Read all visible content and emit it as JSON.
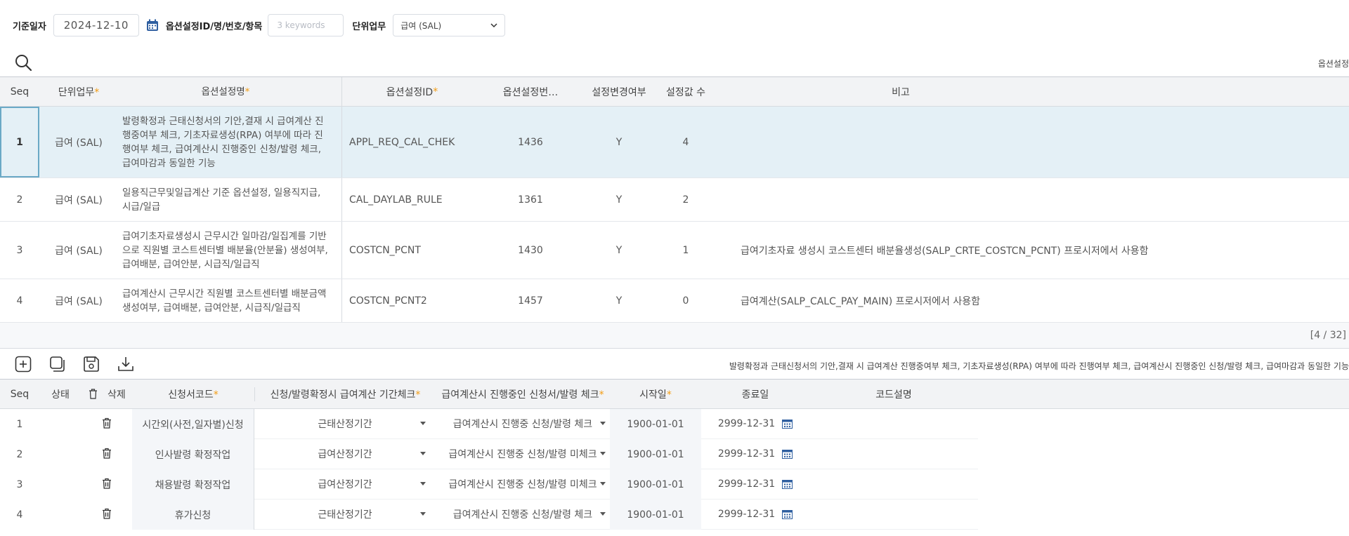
{
  "filter": {
    "base_date_label": "기준일자",
    "base_date_value": "2024-12-10",
    "option_label": "옵션설정ID/명/번호/항목",
    "keyword_placeholder": "3 keywords",
    "unit_label": "단위업무",
    "unit_value": "급여 (SAL)"
  },
  "top_right_label": "옵션설정",
  "grid1": {
    "headers": {
      "seq": "Seq",
      "unit": "단위업무",
      "name": "옵션설정명",
      "id": "옵션설정ID",
      "num": "옵션설정번…",
      "changed": "설정변경여부",
      "count": "설정값 수",
      "note": "비고"
    },
    "rows": [
      {
        "seq": "1",
        "unit": "급여 (SAL)",
        "name": "발령확정과 근태신청서의 기안,결재 시 급여계산 진행중여부 체크,  기초자료생성(RPA) 여부에 따라 진행여부 체크, 급여계산시 진행중인 신청/발령 체크, 급여마감과 동일한 기능",
        "id": "APPL_REQ_CAL_CHEK",
        "num": "1436",
        "changed": "Y",
        "count": "4",
        "note": ""
      },
      {
        "seq": "2",
        "unit": "급여 (SAL)",
        "name": "일용직근무및일급계산 기준 옵션설정, 일용직지급, 시급/일급",
        "id": "CAL_DAYLAB_RULE",
        "num": "1361",
        "changed": "Y",
        "count": "2",
        "note": ""
      },
      {
        "seq": "3",
        "unit": "급여 (SAL)",
        "name": "급여기초자료생성시 근무시간 일마감/일집계를 기반으로 직원별 코스트센터별 배분율(안분율) 생성여부, 급여배분, 급여안분, 시급직/일급직",
        "id": "COSTCN_PCNT",
        "num": "1430",
        "changed": "Y",
        "count": "1",
        "note": "급여기초자료 생성시 코스트센터 배분율생성(SALP_CRTE_COSTCN_PCNT) 프로시저에서 사용함"
      },
      {
        "seq": "4",
        "unit": "급여 (SAL)",
        "name": "급여계산시 근무시간 직원별 코스트센터별 배분금액 생성여부, 급여배분, 급여안분, 시급직/일급직",
        "id": "COSTCN_PCNT2",
        "num": "1457",
        "changed": "Y",
        "count": "0",
        "note": "급여계산(SALP_CALC_PAY_MAIN) 프로시저에서 사용함"
      }
    ],
    "paging": "[4 / 32]"
  },
  "detail_description": "발령확정과 근태신청서의 기안,결재 시 급여계산 진행중여부 체크, 기초자료생성(RPA) 여부에 따라 진행여부 체크, 급여계산시 진행중인 신청/발령 체크, 급여마감과 동일한 기능",
  "grid2": {
    "headers": {
      "seq": "Seq",
      "status": "상태",
      "delete": "삭제",
      "code": "신청서코드",
      "chk1": "신청/발령확정시 급여계산 기간체크",
      "chk2": "급여계산시 진행중인 신청서/발령 체크",
      "start": "시작일",
      "end": "종료일",
      "desc": "코드설명"
    },
    "rows": [
      {
        "seq": "1",
        "code": "시간외(사전,일자별)신청",
        "chk1": "근태산정기간",
        "chk2": "급여계산시 진행중 신청/발령 체크",
        "start": "1900-01-01",
        "end": "2999-12-31"
      },
      {
        "seq": "2",
        "code": "인사발령 확정작업",
        "chk1": "급여산정기간",
        "chk2": "급여계산시 진행중 신청/발령 미체크",
        "start": "1900-01-01",
        "end": "2999-12-31"
      },
      {
        "seq": "3",
        "code": "채용발령 확정작업",
        "chk1": "급여산정기간",
        "chk2": "급여계산시 진행중 신청/발령 미체크",
        "start": "1900-01-01",
        "end": "2999-12-31"
      },
      {
        "seq": "4",
        "code": "휴가신청",
        "chk1": "근태산정기간",
        "chk2": "급여계산시 진행중 신청/발령 체크",
        "start": "1900-01-01",
        "end": "2999-12-31"
      }
    ]
  },
  "icons": {
    "calendar": "calendar-icon",
    "search": "search-icon",
    "add": "add-icon",
    "copy": "copy-icon",
    "save": "save-icon",
    "download": "download-icon",
    "trash": "trash-icon"
  },
  "colors": {
    "selected_row": "#e4f0f6",
    "required_star": "#f39c12",
    "accent_icon": "#2f5fa0"
  }
}
